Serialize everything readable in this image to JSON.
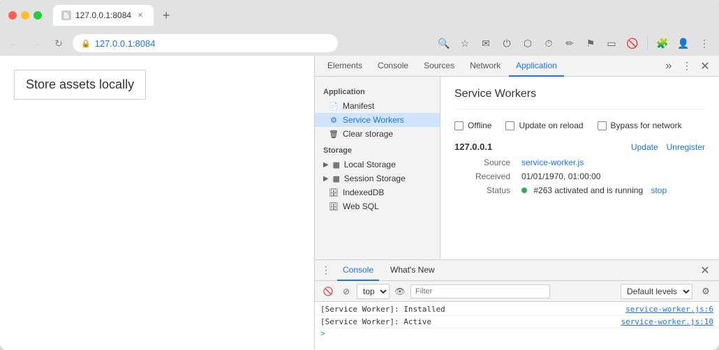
{
  "browser": {
    "tab_title": "127.0.0.1:8084",
    "new_tab_icon": "+",
    "address": "127.0.0.1:8084",
    "address_display": "127.0.0.1:8084"
  },
  "page": {
    "store_assets_button": "Store assets locally"
  },
  "devtools": {
    "tabs": [
      {
        "id": "elements",
        "label": "Elements"
      },
      {
        "id": "console",
        "label": "Console"
      },
      {
        "id": "sources",
        "label": "Sources"
      },
      {
        "id": "network",
        "label": "Network"
      },
      {
        "id": "application",
        "label": "Application"
      }
    ],
    "sidebar": {
      "section_application": "Application",
      "items_application": [
        {
          "id": "manifest",
          "label": "Manifest",
          "icon": "📄"
        },
        {
          "id": "service-workers",
          "label": "Service Workers",
          "icon": "⚙️",
          "active": true
        },
        {
          "id": "clear-storage",
          "label": "Clear storage",
          "icon": "🗑️"
        }
      ],
      "section_storage": "Storage",
      "items_storage": [
        {
          "id": "local-storage",
          "label": "Local Storage",
          "expandable": true
        },
        {
          "id": "session-storage",
          "label": "Session Storage",
          "expandable": true
        },
        {
          "id": "indexeddb",
          "label": "IndexedDB"
        },
        {
          "id": "web-sql",
          "label": "Web SQL"
        }
      ]
    },
    "sw_panel": {
      "title": "Service Workers",
      "offline_label": "Offline",
      "update_on_reload_label": "Update on reload",
      "bypass_for_network_label": "Bypass for network",
      "origin": "127.0.0.1",
      "update_link": "Update",
      "unregister_link": "Unregister",
      "source_label": "Source",
      "source_file": "service-worker.js",
      "received_label": "Received",
      "received_value": "01/01/1970, 01:00:00",
      "status_label": "Status",
      "status_dot_color": "#34a853",
      "status_text": "#263 activated and is running",
      "stop_link": "stop"
    },
    "console_panel": {
      "tabs": [
        {
          "id": "console",
          "label": "Console",
          "active": true
        },
        {
          "id": "whats-new",
          "label": "What's New"
        }
      ],
      "context": "top",
      "filter_placeholder": "Filter",
      "level": "Default levels",
      "logs": [
        {
          "text": "[Service Worker]: Installed",
          "source": "service-worker.js:6"
        },
        {
          "text": "[Service Worker]: Active",
          "source": "service-worker.js:10"
        }
      ],
      "prompt_chevron": ">"
    }
  }
}
